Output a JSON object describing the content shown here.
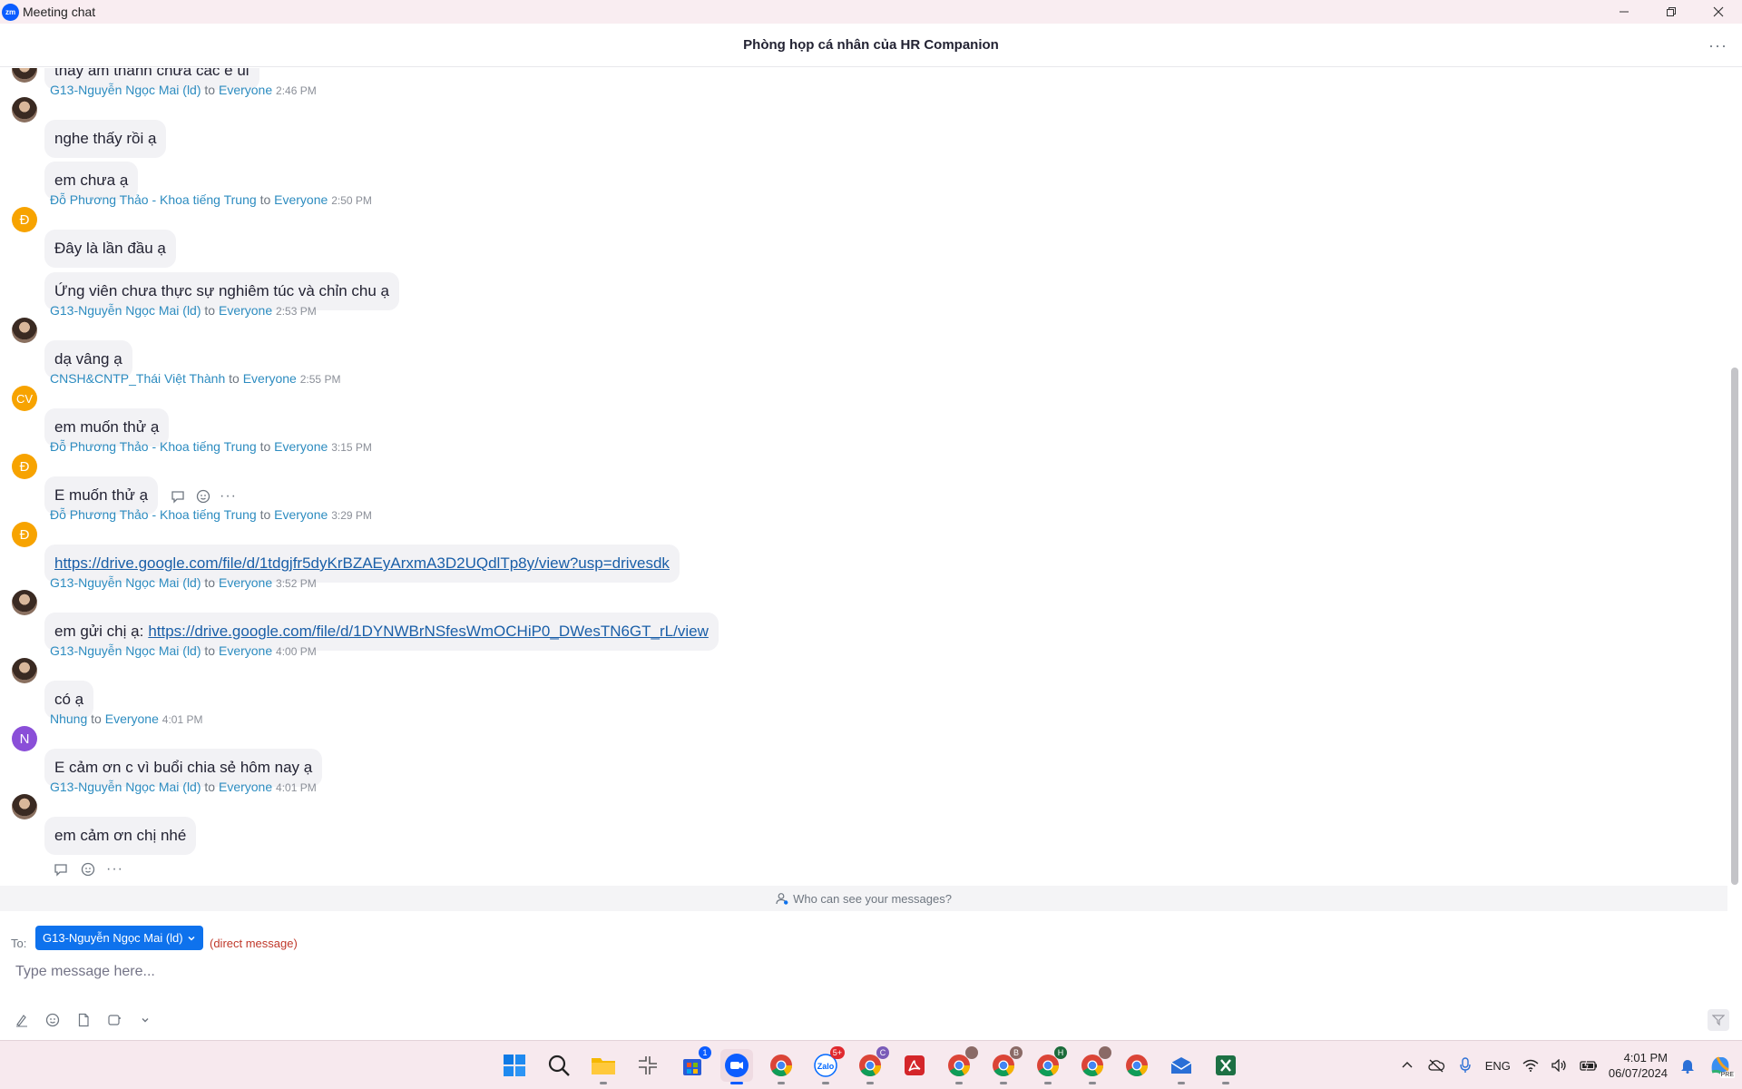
{
  "window": {
    "title": "Meeting chat",
    "logo_text": "zm"
  },
  "header": {
    "title": "Phòng họp cá nhân của HR Companion",
    "more": "···"
  },
  "partial_message": "thấy âm thanh chưa các e  ui",
  "messages": [
    {
      "sender": "G13-Nguyễn Ngọc Mai (ld)",
      "to_word": "to",
      "recipient": "Everyone",
      "time": "2:46 PM",
      "bubbles": [
        "nghe thấy rồi ạ",
        "em chưa ạ"
      ]
    },
    {
      "sender": "Đỗ Phương Thảo - Khoa tiếng Trung",
      "to_word": "to",
      "recipient": "Everyone",
      "time": "2:50 PM",
      "avatar": "Đ",
      "bubbles": [
        "Đây là lần đầu ạ",
        "Ứng viên chưa thực sự nghiêm túc và chỉn chu ạ"
      ]
    },
    {
      "sender": "G13-Nguyễn Ngọc Mai (ld)",
      "to_word": "to",
      "recipient": "Everyone",
      "time": "2:53 PM",
      "bubbles": [
        "dạ vâng ạ"
      ]
    },
    {
      "sender": "CNSH&CNTP_Thái Việt Thành",
      "to_word": "to",
      "recipient": "Everyone",
      "time": "2:55 PM",
      "avatar": "CV",
      "bubbles": [
        "em muốn thử ạ"
      ]
    },
    {
      "sender": "Đỗ Phương Thảo - Khoa tiếng Trung",
      "to_word": "to",
      "recipient": "Everyone",
      "time": "3:15 PM",
      "avatar": "Đ",
      "bubbles": [
        "E muốn thử ạ"
      ]
    },
    {
      "sender": "Đỗ Phương Thảo - Khoa tiếng Trung",
      "to_word": "to",
      "recipient": "Everyone",
      "time": "3:29 PM",
      "avatar": "Đ",
      "link": "https://drive.google.com/file/d/1tdgjfr5dyKrBZAEyArxmA3D2UQdlTp8y/view?usp=drivesdk"
    },
    {
      "sender": "G13-Nguyễn Ngọc Mai (ld)",
      "to_word": "to",
      "recipient": "Everyone",
      "time": "3:52 PM",
      "prefix": "em gửi chị ạ:",
      "link": "https://drive.google.com/file/d/1DYNWBrNSfesWmOCHiP0_DWesTN6GT_rL/view"
    },
    {
      "sender": "G13-Nguyễn Ngọc Mai (ld)",
      "to_word": "to",
      "recipient": "Everyone",
      "time": "4:00 PM",
      "bubbles": [
        "có ạ"
      ]
    },
    {
      "sender": "Nhung",
      "to_word": "to",
      "recipient": "Everyone",
      "time": "4:01 PM",
      "avatar": "N",
      "bubbles": [
        "E cảm ơn c vì buổi chia sẻ hôm nay ạ"
      ]
    },
    {
      "sender": "G13-Nguyễn Ngọc Mai (ld)",
      "to_word": "to",
      "recipient": "Everyone",
      "time": "4:01 PM",
      "bubbles": [
        "em cảm ơn chị nhé"
      ]
    }
  ],
  "hover_more": "···",
  "who_can_see": "Who can see your messages?",
  "compose": {
    "to_label": "To:",
    "to_value": "G13-Nguyễn Ngọc Mai (ld)",
    "direct_label": "(direct message)",
    "placeholder": "Type message here..."
  },
  "taskbar": {
    "badges": {
      "store": "1",
      "zalo": "5+",
      "chrome_c": "C",
      "chrome_b": "B",
      "chrome_h": "H"
    },
    "lang": "ENG",
    "time": "4:01 PM",
    "date": "06/07/2024",
    "copilot_label": "PRE"
  },
  "colors": {
    "accent": "#0e72ed",
    "sender_link": "#2d8cc0",
    "avatar_orange": "#f7a300",
    "avatar_purple": "#8a4fd8",
    "direct_red": "#c0392b"
  }
}
